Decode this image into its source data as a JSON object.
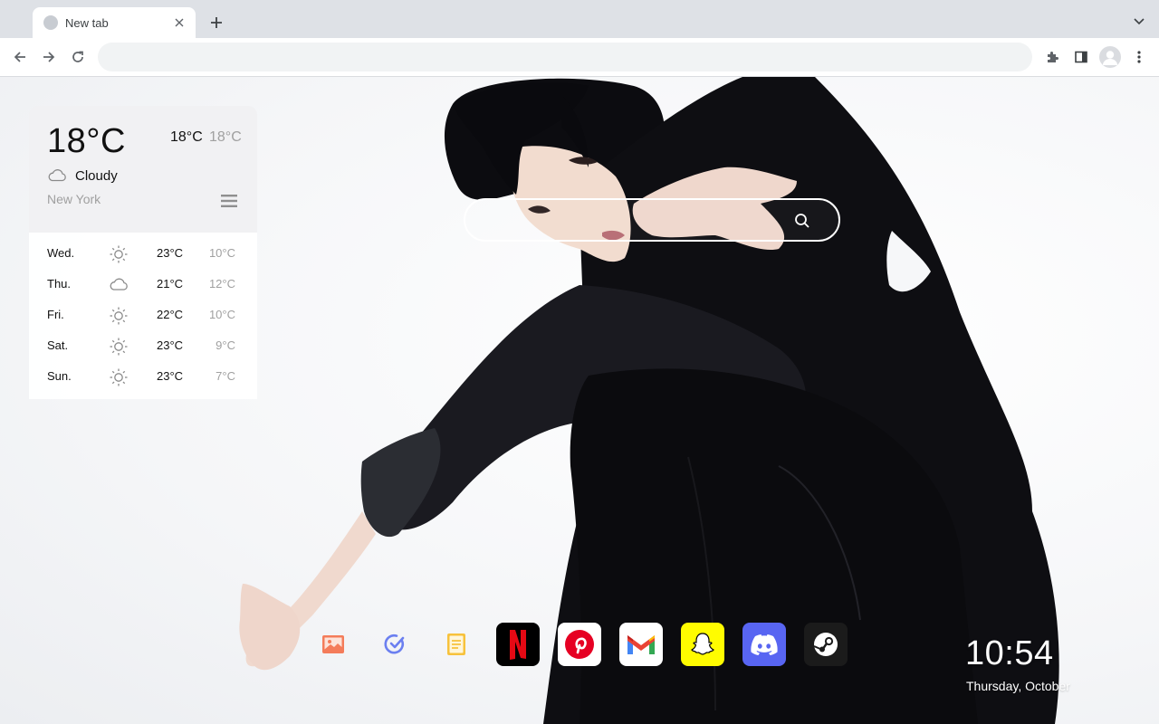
{
  "browser": {
    "tab_title": "New tab",
    "omnibox_value": "",
    "omnibox_placeholder": ""
  },
  "weather": {
    "current_temp": "18°C",
    "high": "18°C",
    "low": "18°C",
    "condition": "Cloudy",
    "condition_icon": "cloud-icon",
    "city": "New York",
    "forecast": [
      {
        "day": "Wed.",
        "icon": "sun-icon",
        "high": "23°C",
        "low": "10°C"
      },
      {
        "day": "Thu.",
        "icon": "cloud-icon",
        "high": "21°C",
        "low": "12°C"
      },
      {
        "day": "Fri.",
        "icon": "sun-icon",
        "high": "22°C",
        "low": "10°C"
      },
      {
        "day": "Sat.",
        "icon": "sun-icon",
        "high": "23°C",
        "low": "9°C"
      },
      {
        "day": "Sun.",
        "icon": "sun-icon",
        "high": "23°C",
        "low": "7°C"
      }
    ]
  },
  "search": {
    "value": "",
    "placeholder": ""
  },
  "dock": {
    "items": [
      {
        "name": "wallpaper",
        "icon": "image-icon"
      },
      {
        "name": "todo",
        "icon": "checkmark-circle-icon"
      },
      {
        "name": "notes",
        "icon": "notepad-icon"
      },
      {
        "name": "netflix",
        "icon": "netflix-icon",
        "letter": "N"
      },
      {
        "name": "pinterest",
        "icon": "pinterest-icon",
        "letter": "P"
      },
      {
        "name": "gmail",
        "icon": "gmail-icon"
      },
      {
        "name": "snapchat",
        "icon": "snapchat-ghost-icon"
      },
      {
        "name": "discord",
        "icon": "discord-icon"
      },
      {
        "name": "steam",
        "icon": "steam-icon"
      }
    ]
  },
  "clock": {
    "time": "10:54",
    "date": "Thursday, October"
  },
  "colors": {
    "netflix": "#e50914",
    "pinterest": "#e60023",
    "snapchat": "#fffc00",
    "discord": "#5865f2",
    "steam": "#1b1b1b",
    "tabstrip": "#dee1e6"
  }
}
